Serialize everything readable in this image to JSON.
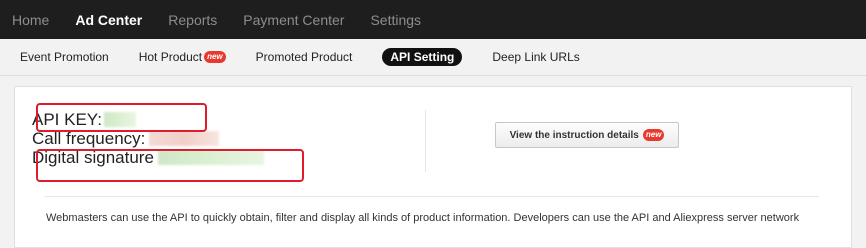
{
  "top_nav": {
    "items": [
      {
        "label": "Home"
      },
      {
        "label": "Ad Center",
        "active": true
      },
      {
        "label": "Reports"
      },
      {
        "label": "Payment Center"
      },
      {
        "label": "Settings"
      }
    ]
  },
  "sub_nav": {
    "items": [
      {
        "label": "Event Promotion"
      },
      {
        "label": "Hot Product",
        "badge": "new"
      },
      {
        "label": "Promoted Product"
      },
      {
        "label": "API Setting",
        "active": true
      },
      {
        "label": "Deep Link URLs"
      }
    ]
  },
  "api_info": {
    "api_key_label": "API KEY:",
    "call_frequency_label": "Call frequency:",
    "digital_signature_label": "Digital signature"
  },
  "instruction_button": {
    "label": "View the instruction details",
    "badge": "new"
  },
  "description": "Webmasters can use the API to quickly obtain, filter and display all kinds of product information. Developers can use the API and Aliexpress server network",
  "colors": {
    "top_nav_bg": "#1e1e1e",
    "highlight_box": "#e01b2b",
    "badge_bg": "#e8392f",
    "active_tab_bg": "#111111"
  }
}
